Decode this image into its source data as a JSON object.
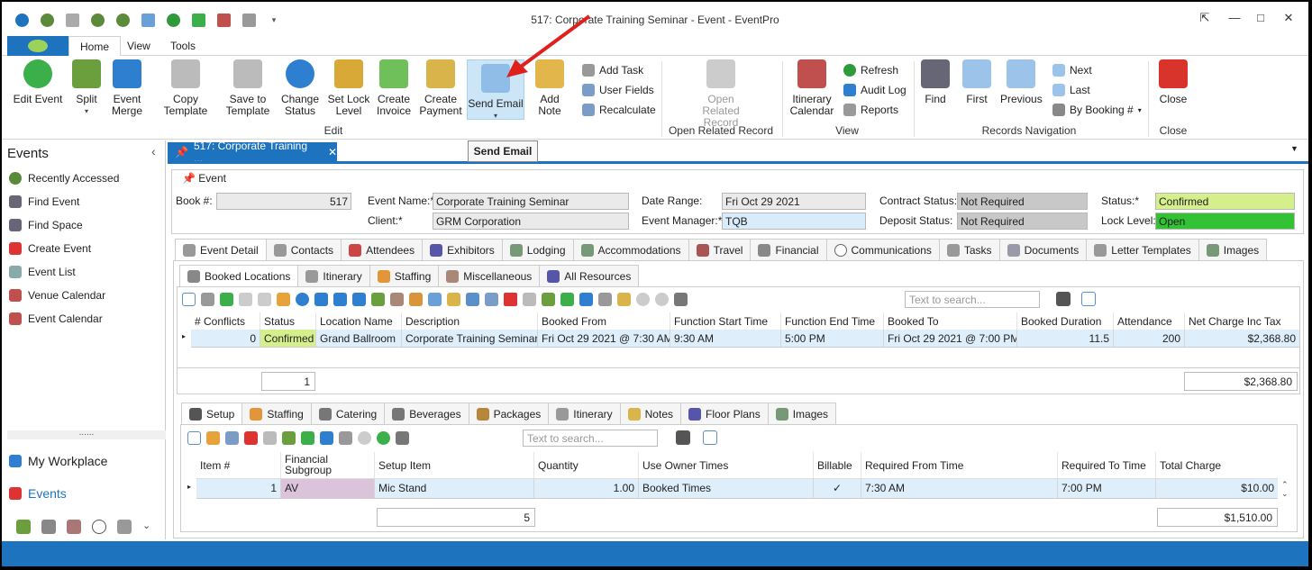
{
  "window": {
    "title": "517: Corporate Training Seminar - Event - EventPro"
  },
  "ribbon_tabs": [
    "Home",
    "View",
    "Tools"
  ],
  "ribbon": {
    "edit": [
      "Edit Event",
      "Split",
      "Event Merge",
      "Copy Template",
      "Save to Template",
      "Change Status",
      "Set Lock Level",
      "Create Invoice",
      "Create Payment",
      "Send Email",
      "Add Note"
    ],
    "edit_small": [
      "Add Task",
      "User Fields",
      "Recalculate"
    ],
    "open_related": "Open Related Record",
    "view_big": "Itinerary Calendar",
    "view_small": [
      "Refresh",
      "Audit Log",
      "Reports"
    ],
    "nav_big": [
      "Find",
      "First",
      "Previous"
    ],
    "nav_small": [
      "Next",
      "Last",
      "By Booking #"
    ],
    "close": "Close",
    "groups": [
      "Edit",
      "Open Related Record",
      "View",
      "Records Navigation",
      "Close"
    ]
  },
  "tooltip": "Send Email",
  "sidebar": {
    "title": "Events",
    "items": [
      "Recently Accessed",
      "Find Event",
      "Find Space",
      "Create Event",
      "Event List",
      "Venue Calendar",
      "Event Calendar"
    ],
    "workplace": "My Workplace",
    "events": "Events",
    "grip": "......"
  },
  "doc_tab": "517: Corporate Training ...",
  "event": {
    "section": "Event",
    "book_label": "Book #:",
    "book": "517",
    "name_label": "Event Name:*",
    "name": "Corporate Training Seminar",
    "client_label": "Client:*",
    "client": "GRM Corporation",
    "date_label": "Date Range:",
    "date": "Fri Oct 29 2021",
    "manager_label": "Event Manager:*",
    "manager": "TQB",
    "contract_label": "Contract Status:",
    "contract": "Not Required",
    "deposit_label": "Deposit Status:",
    "deposit": "Not Required",
    "status_label": "Status:*",
    "status": "Confirmed",
    "lock_label": "Lock Level:",
    "lock": "Open"
  },
  "main_tabs": [
    "Event Detail",
    "Contacts",
    "Attendees",
    "Exhibitors",
    "Lodging",
    "Accommodations",
    "Travel",
    "Financial",
    "Communications",
    "Tasks",
    "Documents",
    "Letter Templates",
    "Images"
  ],
  "sub_tabs": [
    "Booked Locations",
    "Itinerary",
    "Staffing",
    "Miscellaneous",
    "All Resources"
  ],
  "search_placeholder": "Text to search...",
  "loc_grid": {
    "headers": [
      "# Conflicts",
      "Status",
      "Location Name",
      "Description",
      "Booked From",
      "Function Start Time",
      "Function End Time",
      "Booked To",
      "Booked Duration",
      "Attendance",
      "Net Charge Inc Tax"
    ],
    "row": [
      "0",
      "Confirmed",
      "Grand Ballroom",
      "Corporate Training Seminar",
      "Fri Oct 29 2021 @ 7:30 AM",
      "9:30 AM",
      "5:00 PM",
      "Fri Oct 29 2021 @ 7:00 PM",
      "11.5",
      "200",
      "$2,368.80"
    ],
    "count": "1",
    "total": "$2,368.80"
  },
  "lower_tabs": [
    "Setup",
    "Staffing",
    "Catering",
    "Beverages",
    "Packages",
    "Itinerary",
    "Notes",
    "Floor Plans",
    "Images"
  ],
  "setup_grid": {
    "headers": [
      "Item #",
      "Financial Subgroup",
      "Setup Item",
      "Quantity",
      "Use Owner Times",
      "Billable",
      "Required From Time",
      "Required To Time",
      "Total Charge"
    ],
    "row": [
      "1",
      "AV",
      "Mic Stand",
      "1.00",
      "Booked Times",
      "✓",
      "7:30 AM",
      "7:00 PM",
      "$10.00"
    ],
    "count": "5",
    "total": "$1,510.00"
  },
  "colors": {
    "accent": "#1e73be",
    "confirmed": "#d4ef8b",
    "open": "#33c233",
    "selected": "#cde6f7"
  }
}
